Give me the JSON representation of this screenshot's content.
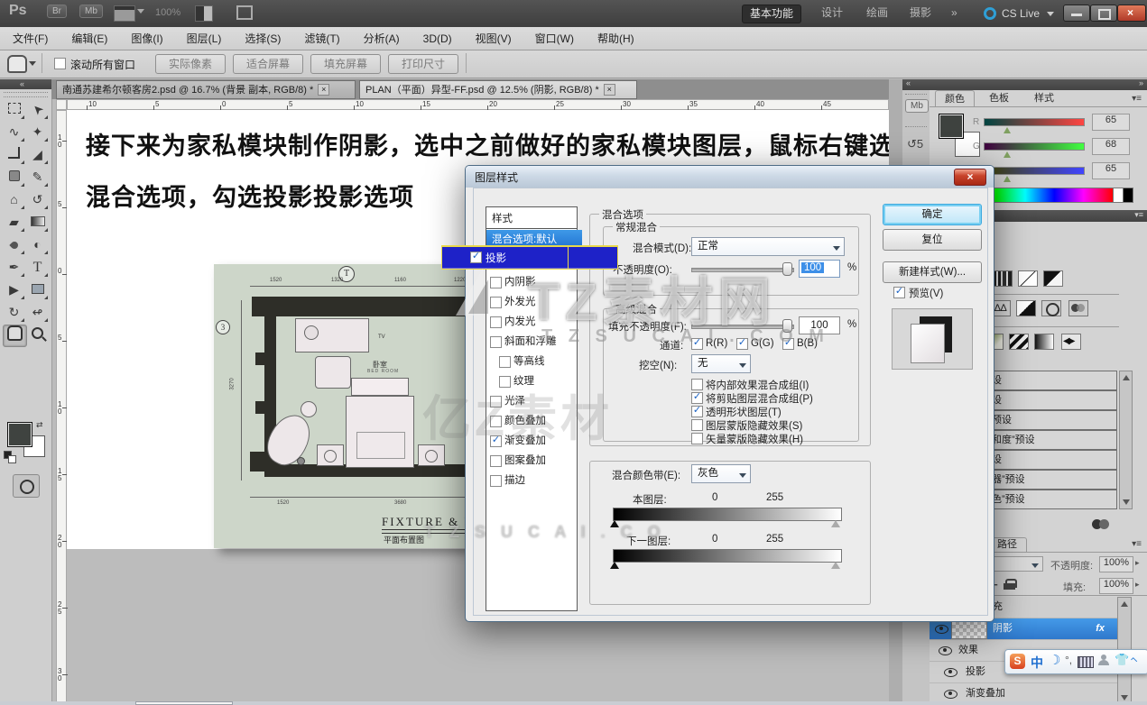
{
  "colors": {
    "selection_blue": "#2f7fd6",
    "drag_blue": "#1e22c8",
    "drag_border": "#e7d84b",
    "close_red": "#c0392b",
    "accent_cyan": "#45b6e8"
  },
  "app": {
    "ps_logo": "Ps",
    "bridge": "Br",
    "minibridge": "Mb",
    "zoom_level": "100%",
    "workspaces": [
      "基本功能",
      "设计",
      "绘画",
      "摄影",
      "»"
    ],
    "cs_live": "CS Live"
  },
  "menu_bar": [
    "文件(F)",
    "编辑(E)",
    "图像(I)",
    "图层(L)",
    "选择(S)",
    "滤镜(T)",
    "分析(A)",
    "3D(D)",
    "视图(V)",
    "窗口(W)",
    "帮助(H)"
  ],
  "options_bar": {
    "scroll_all_windows": "滚动所有窗口",
    "buttons": [
      "实际像素",
      "适合屏幕",
      "填充屏幕",
      "打印尺寸"
    ]
  },
  "document_tabs": [
    "南通苏建希尔顿客房2.psd @ 16.7% (背景 副本, RGB/8) *",
    "PLAN（平面）异型-FF.psd @ 12.5% (阴影, RGB/8) *"
  ],
  "rulers": {
    "horizontal": [
      "10",
      "5",
      "0",
      "5",
      "10",
      "15",
      "20",
      "25",
      "30",
      "35",
      "40",
      "45"
    ],
    "vertical": [
      "10",
      "5",
      "0",
      "5",
      "10",
      "15",
      "20",
      "25",
      "30"
    ]
  },
  "canvas": {
    "instruction_line1": "接下来为家私模块制作阴影，选中之前做好的家私模块图层，鼠标右键选择",
    "instruction_line2": "混合选项，勾选投影投影选项",
    "floorplan": {
      "grid_top": "T",
      "grid_left": "3",
      "room_cn": "卧室",
      "room_en": "BED ROOM",
      "tv": "TV",
      "title": "FIXTURE  &  FU",
      "subtitle": "平面布置图",
      "dims_top": [
        "1520",
        "1320",
        "1160",
        "1220"
      ],
      "dims_bottom": [
        "1520",
        "3680"
      ],
      "dims_left": [
        "3270"
      ]
    }
  },
  "watermark": {
    "brand": "TZ素材网",
    "domain": "T Z S U C A I . C O M",
    "brand2": "亿Z素材",
    "domain2": "T Z S U C A I . C O"
  },
  "dialog": {
    "title": "图层样式",
    "styles": {
      "header": "样式",
      "items": [
        "混合选项:默认",
        "投影",
        "内阴影",
        "外发光",
        "内发光",
        "斜面和浮雕",
        "等高线",
        "纹理",
        "光泽",
        "颜色叠加",
        "渐变叠加",
        "图案叠加",
        "描边"
      ]
    },
    "general": {
      "group": "混合选项",
      "section": "常规混合",
      "blend_mode_label": "混合模式(D):",
      "blend_mode": "正常",
      "opacity_label": "不透明度(O):",
      "opacity": "100",
      "unit": "%"
    },
    "advanced": {
      "section": "高级混合",
      "fill_label": "填充不透明度(F):",
      "fill": "100",
      "unit": "%",
      "channels_label": "通道:",
      "channels": [
        "R(R)",
        "G(G)",
        "B(B)"
      ],
      "knockout_label": "挖空(N):",
      "knockout": "无",
      "options": [
        "将内部效果混合成组(I)",
        "将剪贴图层混合成组(P)",
        "透明形状图层(T)",
        "图层蒙版隐藏效果(S)",
        "矢量蒙版隐藏效果(H)"
      ]
    },
    "blend_if": {
      "label": "混合颜色带(E):",
      "value": "灰色",
      "this_layer": "本图层:",
      "this_min": "0",
      "this_max": "255",
      "under_layer": "下一图层:",
      "under_min": "0",
      "under_max": "255"
    },
    "buttons": {
      "ok": "确定",
      "reset": "复位",
      "new_style": "新建样式(W)...",
      "preview": "预览(V)"
    }
  },
  "panels": {
    "color": {
      "tabs": [
        "颜色",
        "色板",
        "样式"
      ],
      "r_label": "R",
      "g_label": "G",
      "b_label": "B",
      "r": "65",
      "g": "68",
      "b": "65"
    },
    "adjustments": {
      "presets": [
        "设",
        "设",
        "预设",
        "和度”预设",
        "设",
        "器”预设",
        "色”预设"
      ]
    },
    "layers": {
      "tab_fragment": "路径",
      "opacity_label": "不透明度:",
      "opacity": "100%",
      "fill_label": "填充:",
      "fill": "100%",
      "row_fragment": "充",
      "selected_layer": "阴影",
      "fx": "fx",
      "effects": "效果",
      "effect1": "投影",
      "effect2": "渐变叠加"
    }
  },
  "ime": {
    "logo": "S",
    "lang": "中"
  }
}
